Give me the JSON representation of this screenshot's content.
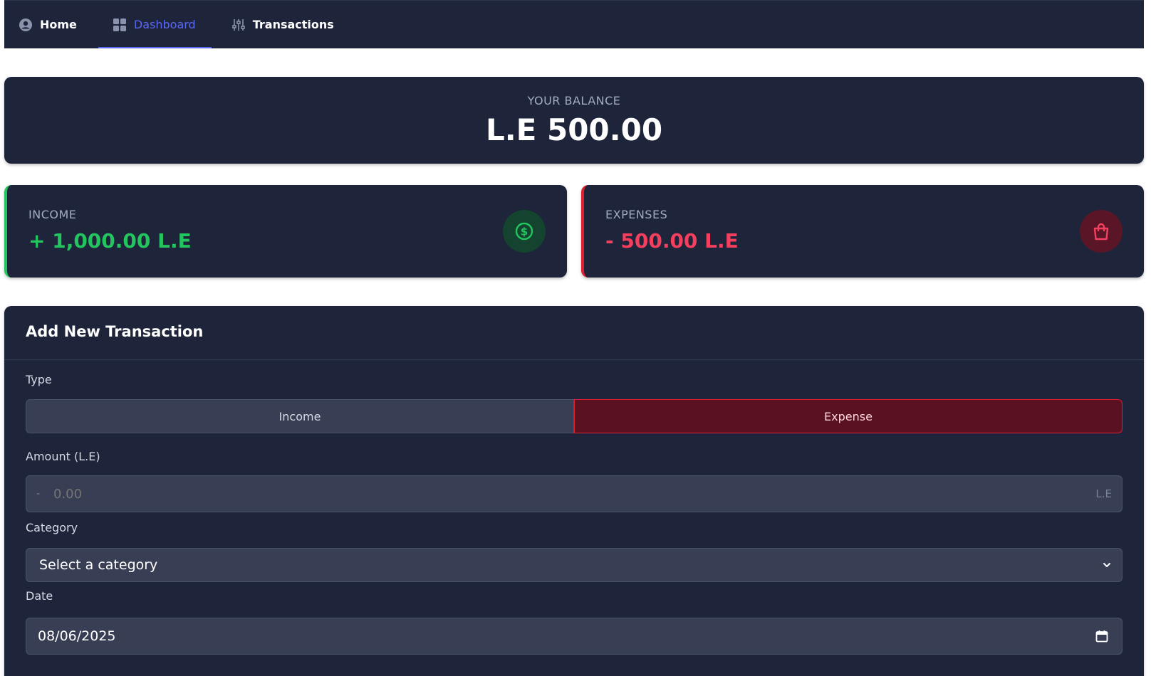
{
  "nav": {
    "items": [
      {
        "label": "Home",
        "icon": "user-circle-icon"
      },
      {
        "label": "Dashboard",
        "icon": "dashboard-grid-icon",
        "active": true
      },
      {
        "label": "Transactions",
        "icon": "sliders-icon"
      }
    ]
  },
  "balance": {
    "label": "YOUR BALANCE",
    "value": "L.E 500.00"
  },
  "income": {
    "label": "INCOME",
    "value": "+ 1,000.00 L.E",
    "icon": "dollar-circle-icon",
    "color": "#22c55e"
  },
  "expenses": {
    "label": "EXPENSES",
    "value": "- 500.00 L.E",
    "icon": "shopping-bag-icon",
    "color": "#f43f5e"
  },
  "form": {
    "title": "Add New Transaction",
    "type_label": "Type",
    "type_income": "Income",
    "type_expense": "Expense",
    "selected_type": "Expense",
    "amount_label": "Amount (L.E)",
    "amount_prefix": "-",
    "amount_placeholder": "0.00",
    "amount_suffix": "L.E",
    "category_label": "Category",
    "category_value": "Select a category",
    "date_label": "Date",
    "date_value": "08/06/2025"
  },
  "colors": {
    "accent": "#5a68f0",
    "card_bg": "#1e253a"
  }
}
